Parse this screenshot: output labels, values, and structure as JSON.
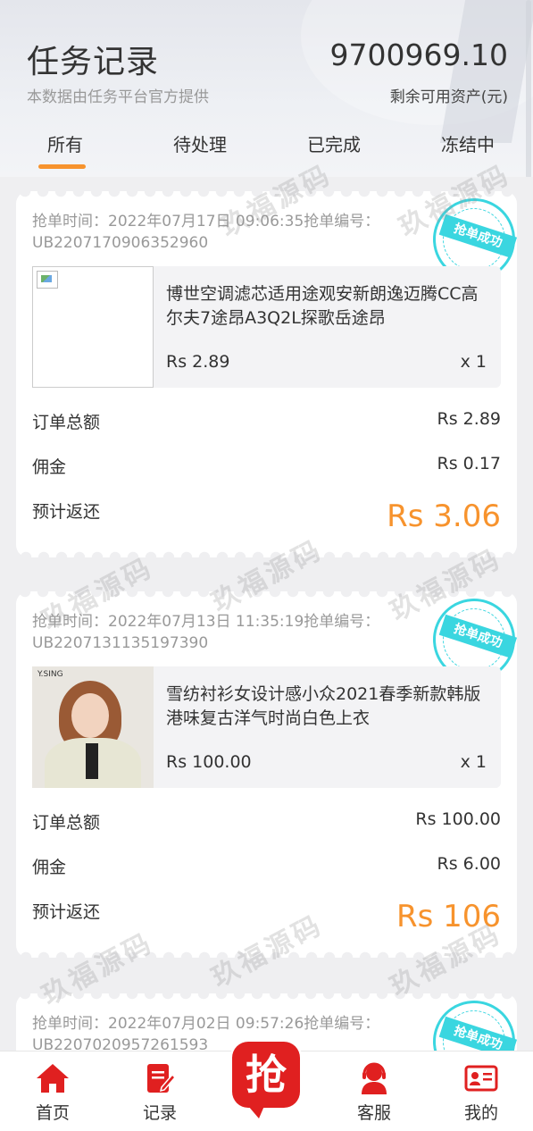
{
  "header": {
    "title": "任务记录",
    "subtitle": "本数据由任务平台官方提供",
    "balance": "9700969.10",
    "balance_label": "剩余可用资产(元)"
  },
  "tabs": [
    "所有",
    "待处理",
    "已完成",
    "冻结中"
  ],
  "active_tab": 0,
  "watermark_text": "玖福源码",
  "stamp_text": "抢单成功",
  "orders": [
    {
      "order_line": "抢单时间：2022年07月17日 09:06:35抢单编号：UB2207170906352960",
      "product_name": "博世空调滤芯适用途观安新朗逸迈腾CC高尔夫7途昂A3Q2L探歌岳途昂",
      "price": "Rs 2.89",
      "qty": "x 1",
      "total_label": "订单总额",
      "total": "Rs 2.89",
      "commission_label": "佣金",
      "commission": "Rs 0.17",
      "return_label": "预计返还",
      "return": "Rs 3.06",
      "image": "broken-image"
    },
    {
      "order_line": "抢单时间：2022年07月13日 11:35:19抢单编号：UB2207131135197390",
      "product_name": "雪纺衬衫女设计感小众2021春季新款韩版港味复古洋气时尚白色上衣",
      "price": "Rs 100.00",
      "qty": "x 1",
      "total_label": "订单总额",
      "total": "Rs 100.00",
      "commission_label": "佣金",
      "commission": "Rs 6.00",
      "return_label": "预计返还",
      "return": "Rs 106",
      "image": "product-photo",
      "brand": "Y.SING"
    },
    {
      "order_line": "抢单时间：2022年07月02日 09:57:26抢单编号：UB2207020957261593"
    }
  ],
  "bottom_nav": {
    "home": "首页",
    "records": "记录",
    "grab": "抢",
    "service": "客服",
    "mine": "我的"
  },
  "colors": {
    "accent": "#f7932d",
    "stamp": "#3ad6e0",
    "nav_red": "#e02020"
  }
}
